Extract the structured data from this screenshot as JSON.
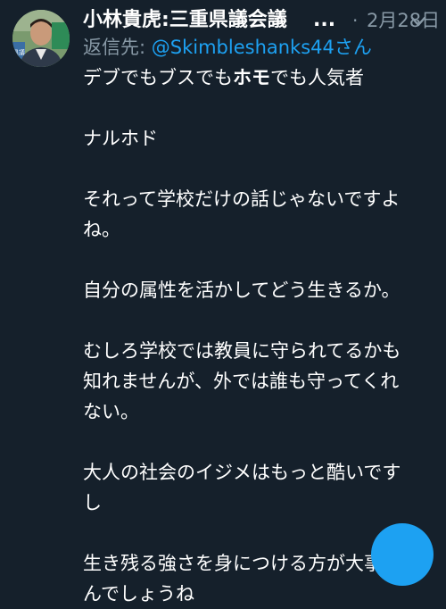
{
  "tweet": {
    "author_name": "小林貴虎:三重県議会議",
    "truncation": "...",
    "separator": "·",
    "date": "2月28日",
    "reply_label": "返信先:",
    "reply_handle": "@Skimbleshanks44さん",
    "body": {
      "line1_part1": "デブでもブスでも",
      "line1_bold": "ホモ",
      "line1_part2": "でも人気者",
      "line2": "ナルホド",
      "line3": "それって学校だけの話じゃないですよ",
      "line4": "ね。",
      "line5": "自分の属性を活かしてどう生きるか。",
      "line6": "むしろ学校では教員に守られてるかも",
      "line7": "知れませんが、外では誰も守ってくれ",
      "line8": "ない。",
      "line9": "大人の社会のイジメはもっと酷いです",
      "line10": "し",
      "line11": "生き残る強さを身につける方が大事な",
      "line12": "んでしょうね"
    }
  },
  "avatar": {
    "sign_text": "県議"
  },
  "icons": {
    "chevron": "chevron-down-icon",
    "fab": "compose-tweet-fab"
  },
  "colors": {
    "background": "#15202b",
    "text": "#ffffff",
    "muted": "#8899a6",
    "accent": "#1da1f2"
  }
}
